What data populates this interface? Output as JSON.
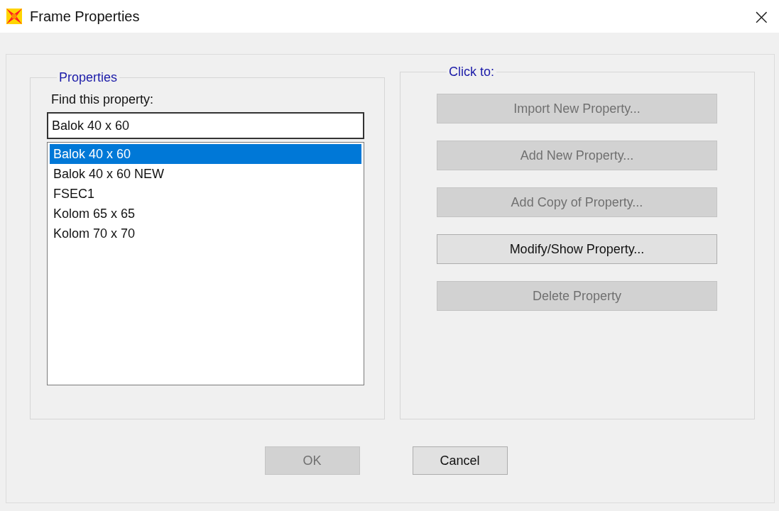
{
  "window": {
    "title": "Frame Properties",
    "close": "×"
  },
  "properties": {
    "legend": "Properties",
    "find_label": "Find this property:",
    "find_value": "Balok 40 x 60",
    "items": [
      {
        "label": "Balok 40 x 60",
        "selected": true
      },
      {
        "label": "Balok 40 x 60 NEW",
        "selected": false
      },
      {
        "label": "FSEC1",
        "selected": false
      },
      {
        "label": "Kolom 65 x 65",
        "selected": false
      },
      {
        "label": "Kolom 70 x 70",
        "selected": false
      }
    ]
  },
  "actions": {
    "legend": "Click to:",
    "buttons": [
      {
        "label": "Import New Property...",
        "disabled": true
      },
      {
        "label": "Add New Property...",
        "disabled": true
      },
      {
        "label": "Add Copy of Property...",
        "disabled": true
      },
      {
        "label": "Modify/Show Property...",
        "disabled": false
      },
      {
        "label": "Delete Property",
        "disabled": true
      }
    ]
  },
  "footer": [
    {
      "label": "OK",
      "disabled": true
    },
    {
      "label": "Cancel",
      "disabled": false
    }
  ]
}
